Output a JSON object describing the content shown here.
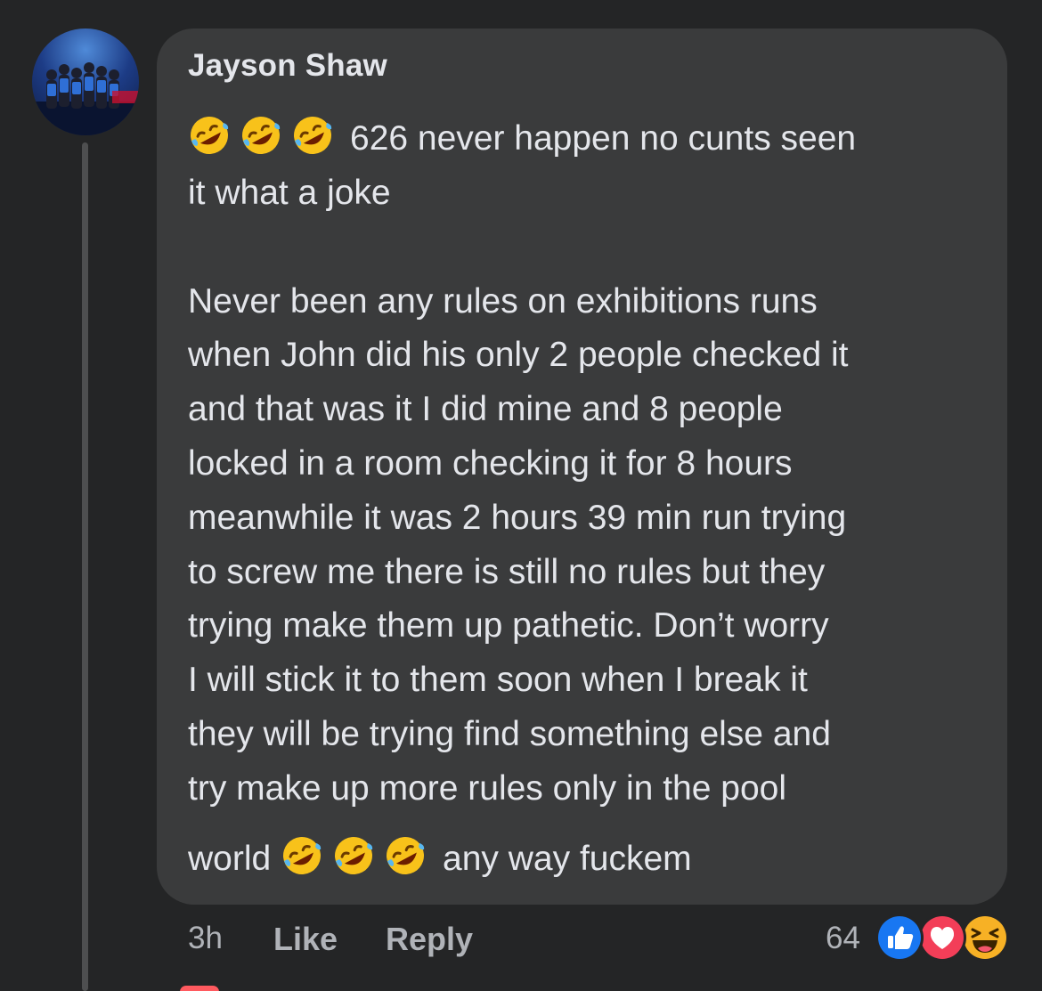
{
  "comment": {
    "author": "Jayson Shaw",
    "lines": [
      "626 never happen no cunts seen",
      "it what a joke",
      "",
      "Never been any rules on exhibitions runs",
      "when John did his only 2 people checked it",
      "and that was it I did mine and 8 people",
      "locked in a room checking it for 8 hours",
      "meanwhile it was 2 hours 39 min run trying",
      "to screw me there is still no rules but they",
      "trying make them up pathetic. Don’t worry",
      "I will stick it to them soon when I break it",
      "they will be trying find something else and",
      "try make up more rules only in the pool"
    ],
    "last_line_start": "world",
    "last_line_end": "any way fuckem",
    "emoji_name": "rolling-on-floor-laughing"
  },
  "footer": {
    "time": "3h",
    "like_label": "Like",
    "reply_label": "Reply",
    "reaction_count": "64",
    "reactions": [
      "like-reaction",
      "love-reaction",
      "haha-reaction"
    ]
  },
  "colors": {
    "background": "#242526",
    "bubble": "#3a3b3c",
    "text": "#e4e6eb",
    "secondary_text": "#b0b3b8",
    "like_blue": "#1877f2",
    "love_red": "#f33e58",
    "haha_yellow": "#f7b125"
  }
}
